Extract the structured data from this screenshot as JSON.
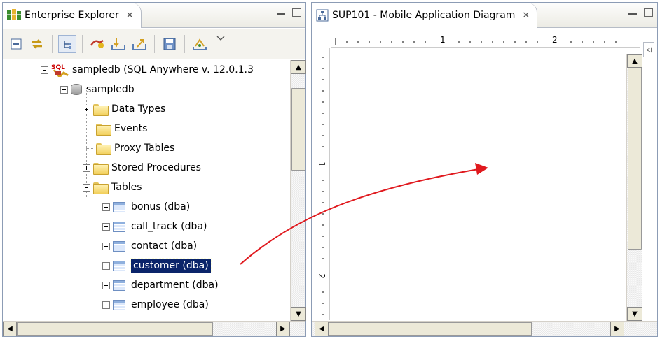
{
  "left_panel": {
    "tab_title": "Enterprise Explorer",
    "tab_close": "✕",
    "tree": [
      {
        "label": "sampledb (SQL Anywhere v. 12.0.1.3",
        "icon": "sql-anywhere-icon",
        "level": 0,
        "expander": "minus"
      },
      {
        "label": "sampledb",
        "icon": "database-icon",
        "level": 1,
        "expander": "minus"
      },
      {
        "label": "Data Types",
        "icon": "folder-icon",
        "level": 2,
        "expander": "plus"
      },
      {
        "label": "Events",
        "icon": "folder-icon",
        "level": 2,
        "expander": "none"
      },
      {
        "label": "Proxy Tables",
        "icon": "folder-icon",
        "level": 2,
        "expander": "none"
      },
      {
        "label": "Stored Procedures",
        "icon": "folder-icon",
        "level": 2,
        "expander": "plus"
      },
      {
        "label": "Tables",
        "icon": "folder-icon",
        "level": 2,
        "expander": "minus"
      },
      {
        "label": "bonus (dba)",
        "icon": "table-icon",
        "level": 3,
        "expander": "plus"
      },
      {
        "label": "call_track (dba)",
        "icon": "table-icon",
        "level": 3,
        "expander": "plus"
      },
      {
        "label": "contact (dba)",
        "icon": "table-icon",
        "level": 3,
        "expander": "plus"
      },
      {
        "label": "customer (dba)",
        "icon": "table-icon",
        "level": 3,
        "expander": "plus",
        "selected": true
      },
      {
        "label": "department (dba)",
        "icon": "table-icon",
        "level": 3,
        "expander": "plus"
      },
      {
        "label": "employee (dba)",
        "icon": "table-icon",
        "level": 3,
        "expander": "plus"
      }
    ],
    "toolbar_icons": [
      "collapse-all-icon",
      "link-with-editor-icon",
      "tree-layout-icon",
      "connect-icon",
      "import-icon",
      "export-icon",
      "save-icon",
      "deploy-icon",
      "view-menu-icon"
    ]
  },
  "right_panel": {
    "tab_title": "SUP101 - Mobile Application Diagram",
    "tab_close": "✕",
    "ruler_h_labels": [
      "1",
      "2"
    ],
    "ruler_v_labels": [
      "1",
      "2"
    ],
    "collapse_glyph": "◁"
  },
  "colors": {
    "selection": "#0a246a",
    "arrow": "#e0191e"
  }
}
